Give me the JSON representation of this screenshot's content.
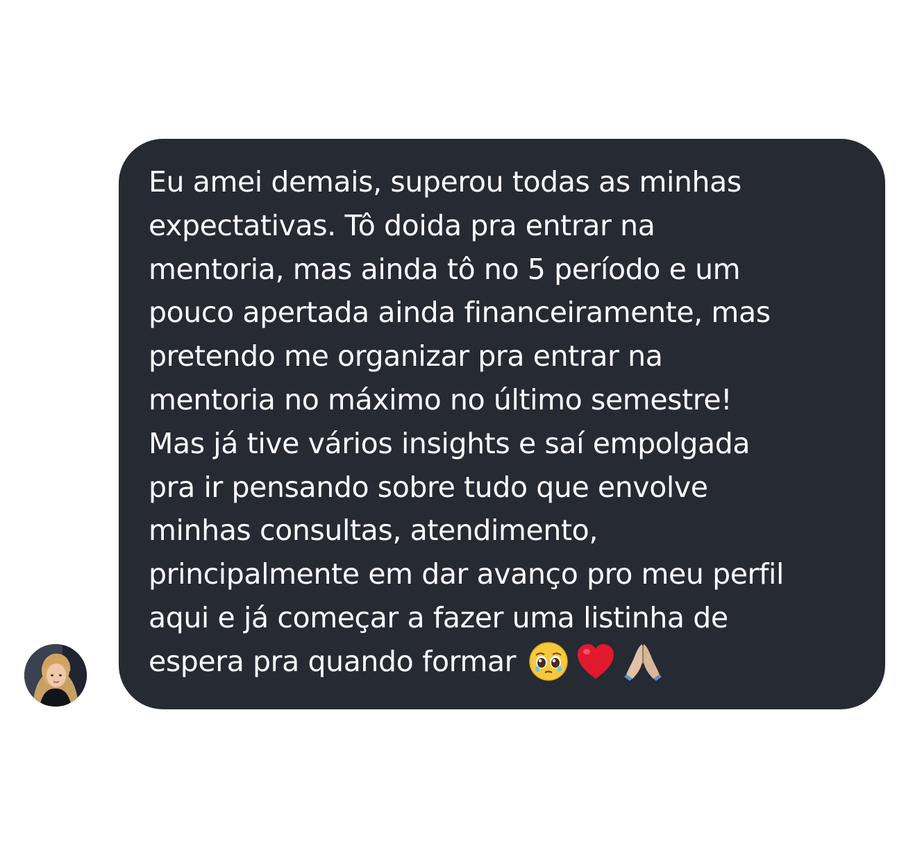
{
  "message": {
    "lines": [
      "Eu amei demais, superou todas as minhas",
      "expectativas. Tô doida pra entrar na",
      "mentoria, mas ainda tô no 5 período e um",
      "pouco apertada ainda financeiramente, mas",
      "pretendo me organizar pra entrar na",
      "mentoria no máximo no último semestre!",
      "Mas já tive vários insights e saí empolgada",
      "pra ir pensando sobre tudo que envolve",
      "minhas consultas, atendimento,",
      "principalmente em dar avanço pro meu perfil",
      "aqui e já começar a fazer uma listinha de"
    ],
    "last_line": "espera pra quando formar",
    "emojis": [
      "pleading-face-icon",
      "red-heart-icon",
      "folded-hands-icon"
    ]
  },
  "colors": {
    "bubble": "#262a33",
    "text": "#ffffff",
    "background": "#ffffff"
  }
}
